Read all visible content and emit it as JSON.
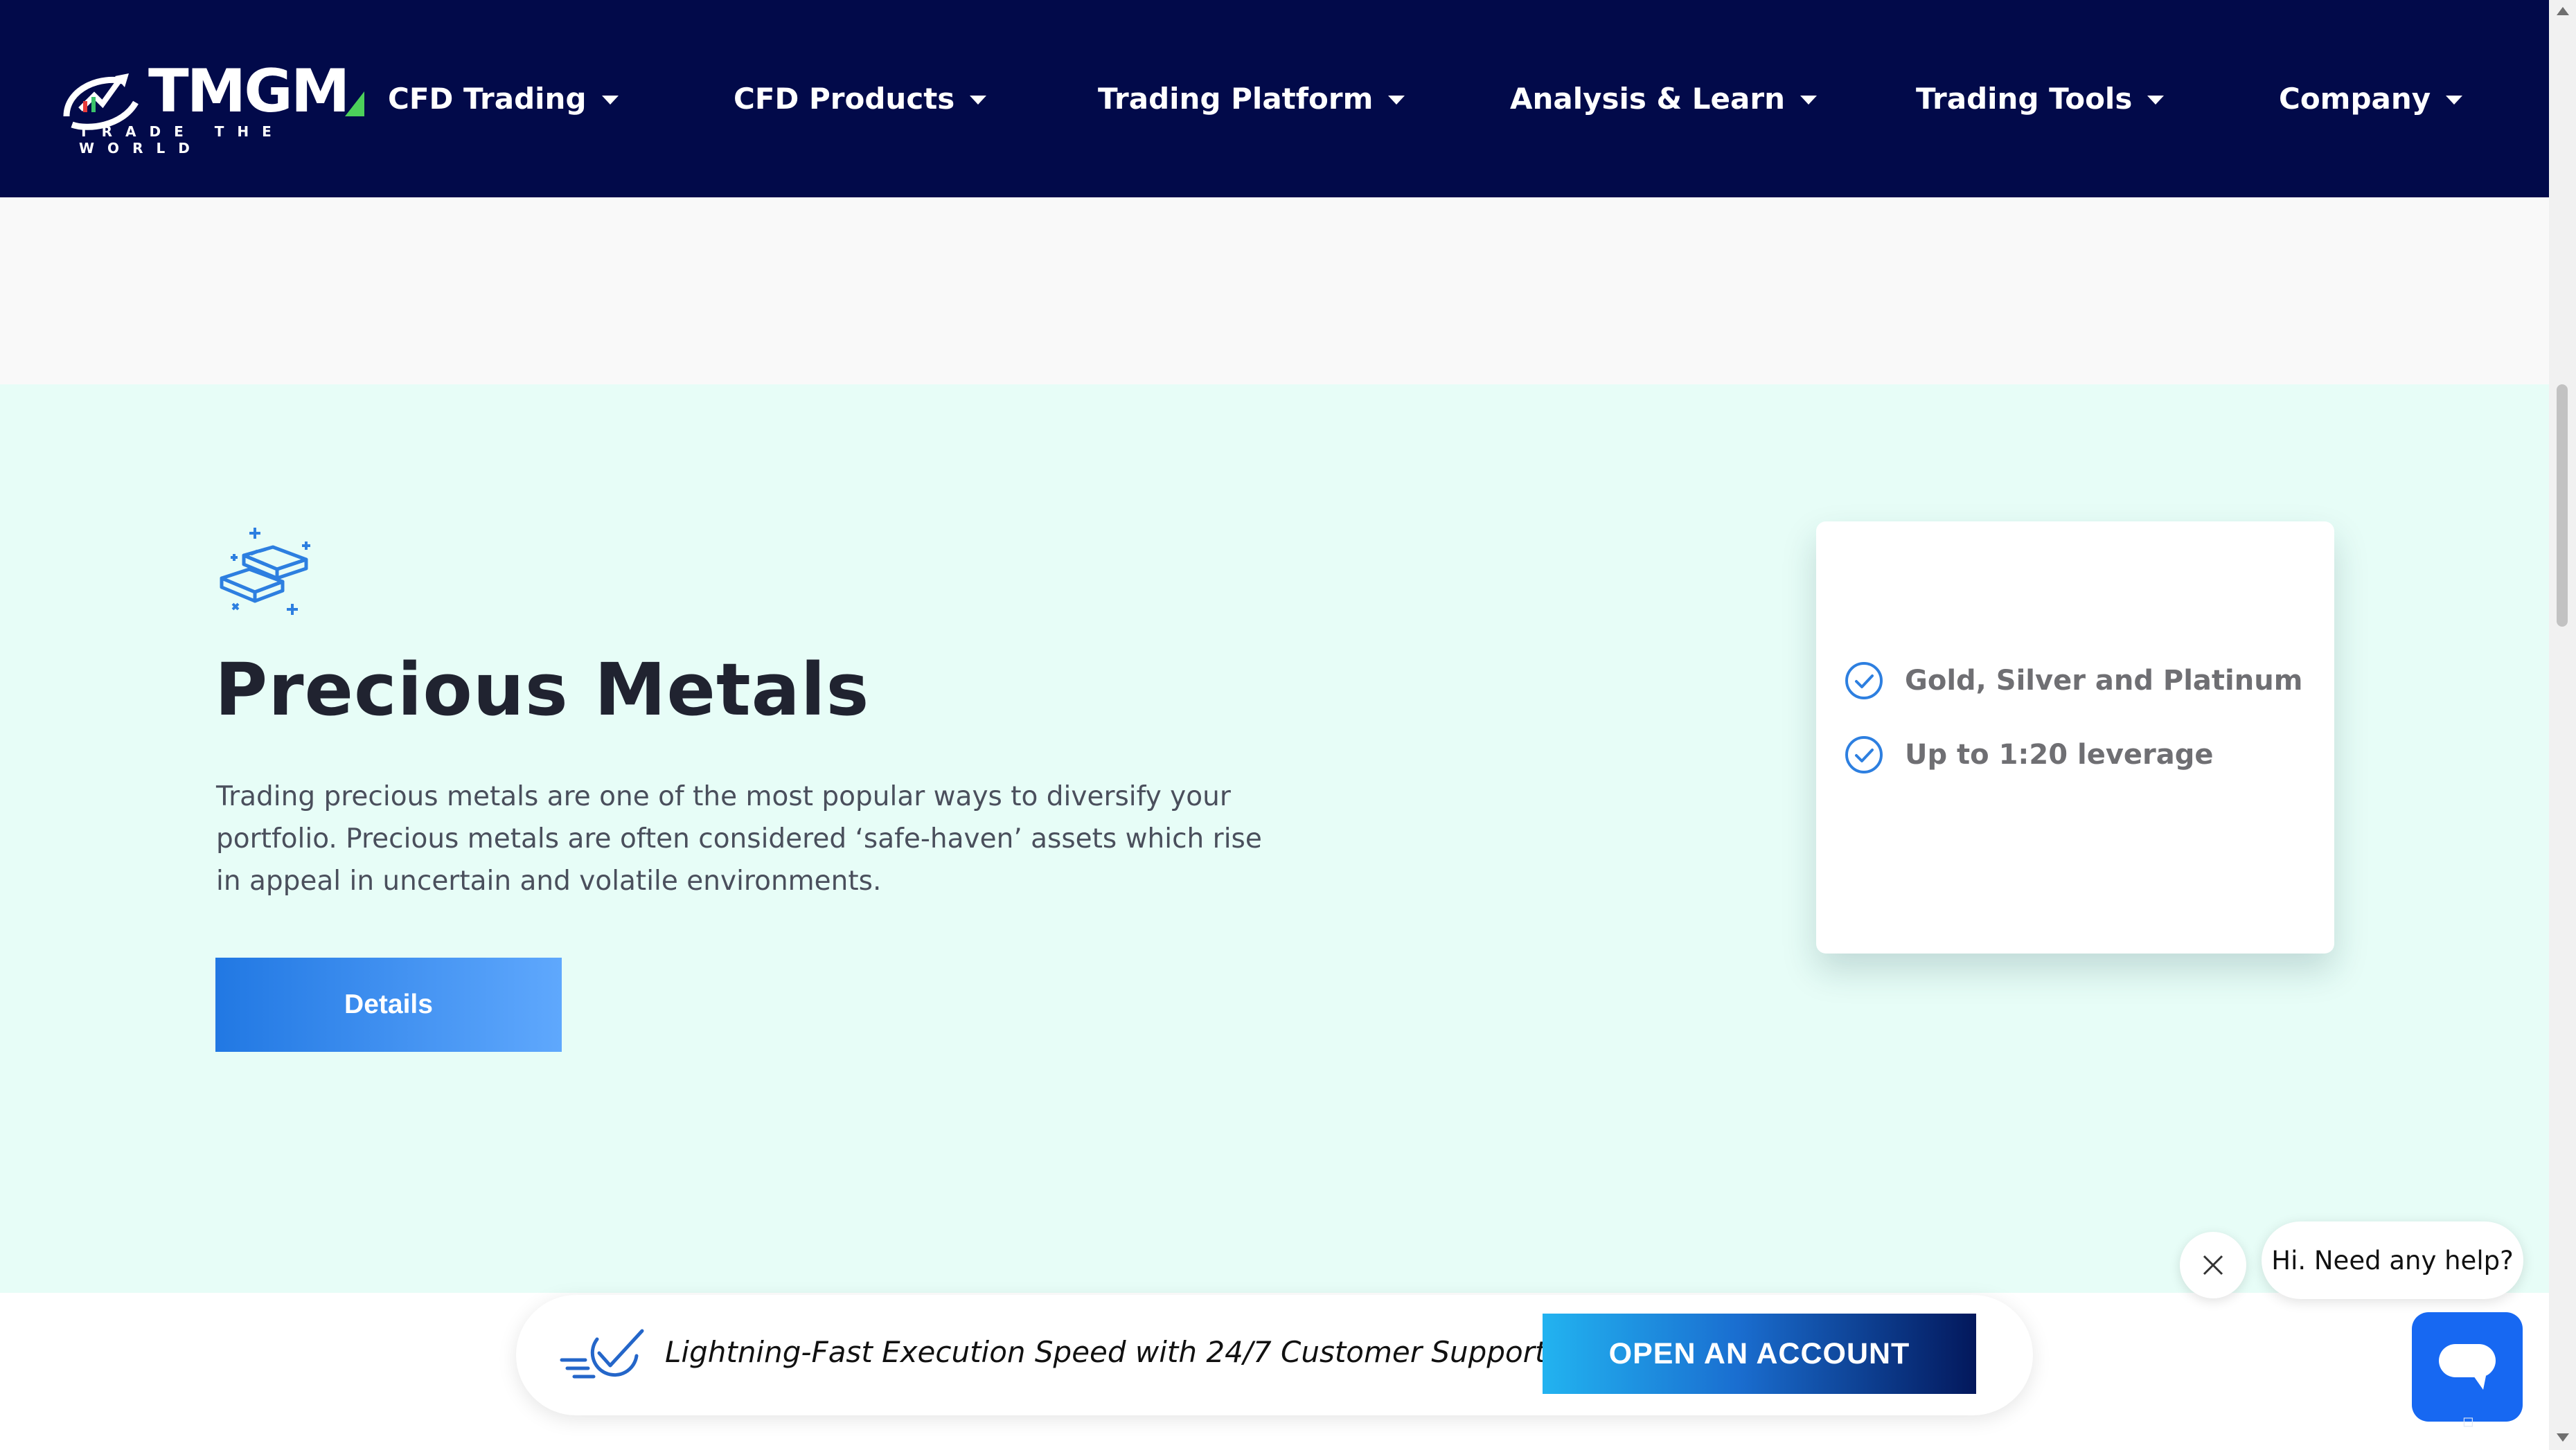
{
  "logo": {
    "word": "TMGM",
    "tagline": "TRADE THE WORLD"
  },
  "nav": {
    "items": [
      {
        "label": "CFD Trading"
      },
      {
        "label": "CFD Products"
      },
      {
        "label": "Trading Platform"
      },
      {
        "label": "Analysis & Learn"
      },
      {
        "label": "Trading Tools"
      },
      {
        "label": "Company"
      }
    ]
  },
  "hero": {
    "icon": "gold-bars-icon",
    "title": "Precious Metals",
    "description": "Trading precious metals are one of the most popular ways to diversify your portfolio. Precious metals are often considered ‘safe-haven’ assets which rise in appeal in uncertain and volatile environments.",
    "details_label": "Details"
  },
  "features": [
    {
      "text": "Gold, Silver and Platinum"
    },
    {
      "text": "Up to 1:20 leverage"
    }
  ],
  "promo": {
    "text": "Lightning-Fast Execution Speed with 24/7 Customer Support",
    "button": "OPEN AN ACCOUNT"
  },
  "chat": {
    "bubble": "Hi. Need any help?"
  },
  "colors": {
    "nav_bg": "#020a4a",
    "hero_bg": "#e7fdf7",
    "accent_blue": "#2178e3",
    "chat_blue": "#1768f2"
  }
}
